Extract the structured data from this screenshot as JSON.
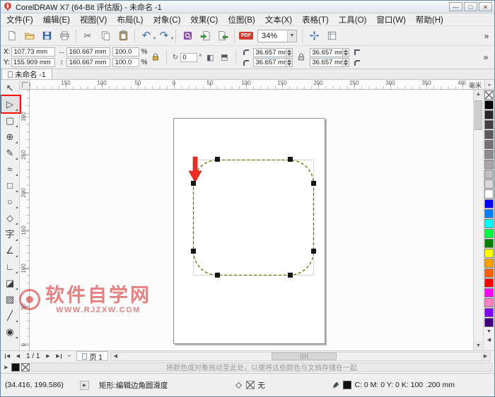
{
  "window": {
    "title": "CorelDRAW X7 (64-Bit 评估版) - 未命名 -1",
    "minimize_label": "—",
    "maximize_label": "□",
    "close_label": "×"
  },
  "menu": {
    "items": [
      "文件(F)",
      "编辑(E)",
      "视图(V)",
      "布局(L)",
      "对象(C)",
      "效果(C)",
      "位图(B)",
      "文本(X)",
      "表格(T)",
      "工具(O)",
      "窗口(W)",
      "帮助(H)"
    ]
  },
  "toolbar": {
    "zoom_value": "34%",
    "pdf_label": "PDF",
    "overflow_label": "»",
    "icons": [
      "new-document",
      "open-folder",
      "save",
      "print",
      "cut",
      "copy",
      "paste",
      "undo",
      "redo",
      "search-content",
      "import",
      "export",
      "publish-to-pdf",
      "zoom-level-combo",
      "fullscreen-preview",
      "view-options",
      "toolbar-overflow"
    ]
  },
  "property_bar": {
    "x_label": "X:",
    "x_value": "107.73 mm",
    "y_label": "Y:",
    "y_value": "155.909 mm",
    "width_value": "160.667 mm",
    "height_value": "160.667 mm",
    "scale_h": "100.0",
    "scale_v": "100.0",
    "percent_label": "%",
    "angle_value": "0",
    "angle_unit": "°",
    "corner_radius": [
      "36.657 mm",
      "36.657 mm",
      "36.657 mm",
      "36.657 mm"
    ],
    "overflow_label": "»"
  },
  "document_tab": {
    "label": "未命名 -1"
  },
  "rulers": {
    "unit_label": "毫米",
    "h_labels": [
      "150",
      "100",
      "50",
      "0",
      "50",
      "100",
      "150",
      "200",
      "250",
      "300",
      "350",
      "400"
    ],
    "v_labels": [
      "300",
      "250",
      "200",
      "150",
      "100",
      "50",
      "0"
    ]
  },
  "toolbox": {
    "tools": [
      {
        "name": "pick-tool",
        "glyph": "↖",
        "flyout": false,
        "highlighted": false
      },
      {
        "name": "shape-tool",
        "glyph": "▷",
        "flyout": true,
        "highlighted": true
      },
      {
        "name": "crop-tool",
        "glyph": "▢",
        "flyout": true,
        "highlighted": false
      },
      {
        "name": "zoom-tool",
        "glyph": "⊕",
        "flyout": true,
        "highlighted": false
      },
      {
        "name": "freehand-tool",
        "glyph": "✎",
        "flyout": true,
        "highlighted": false
      },
      {
        "name": "artistic-media-tool",
        "glyph": "≈",
        "flyout": true,
        "highlighted": false
      },
      {
        "name": "rectangle-tool",
        "glyph": "□",
        "flyout": true,
        "highlighted": false
      },
      {
        "name": "ellipse-tool",
        "glyph": "○",
        "flyout": true,
        "highlighted": false
      },
      {
        "name": "polygon-tool",
        "glyph": "◇",
        "flyout": true,
        "highlighted": false
      },
      {
        "name": "text-tool",
        "glyph": "字",
        "flyout": true,
        "highlighted": false
      },
      {
        "name": "parallel-dimension-tool",
        "glyph": "∠",
        "flyout": true,
        "highlighted": false
      },
      {
        "name": "connector-tool",
        "glyph": "∟",
        "flyout": true,
        "highlighted": false
      },
      {
        "name": "drop-shadow-tool",
        "glyph": "◪",
        "flyout": true,
        "highlighted": false
      },
      {
        "name": "transparency-tool",
        "glyph": "▨",
        "flyout": false,
        "highlighted": false
      },
      {
        "name": "color-eyedropper-tool",
        "glyph": "╱",
        "flyout": true,
        "highlighted": false
      },
      {
        "name": "interactive-fill-tool",
        "glyph": "◉",
        "flyout": true,
        "highlighted": false
      }
    ]
  },
  "canvas": {
    "watermark_line1": "软件自学网",
    "watermark_line2": "WWW.RJZXW.COM"
  },
  "palette": {
    "colors": [
      "none",
      "#000000",
      "#262626",
      "#404040",
      "#595959",
      "#737373",
      "#8c8c8c",
      "#a6a6a6",
      "#bfbfbf",
      "#d9d9d9",
      "#ffffff",
      "#0000ff",
      "#0080ff",
      "#00ffff",
      "#00ff40",
      "#008000",
      "#ffff00",
      "#ffa000",
      "#ff6000",
      "#ff0000",
      "#ff00ff",
      "#ff80c0",
      "#8000ff",
      "#400080"
    ]
  },
  "page_nav": {
    "current_page": "1 / 1",
    "page_tab_label": "页 1"
  },
  "document_palette": {
    "hint": "将颜色或对象拖动至此处，以便将这些颜色与文档存储在一起"
  },
  "status_bar": {
    "coords": "(34.416, 199.586)",
    "tool_hint": "矩形:编辑边角圆滑度",
    "fill_none_label": "无",
    "outline_color_text": "C: 0 M: 0 Y: 0 K: 100",
    "outline_width_text": ".200 mm"
  }
}
